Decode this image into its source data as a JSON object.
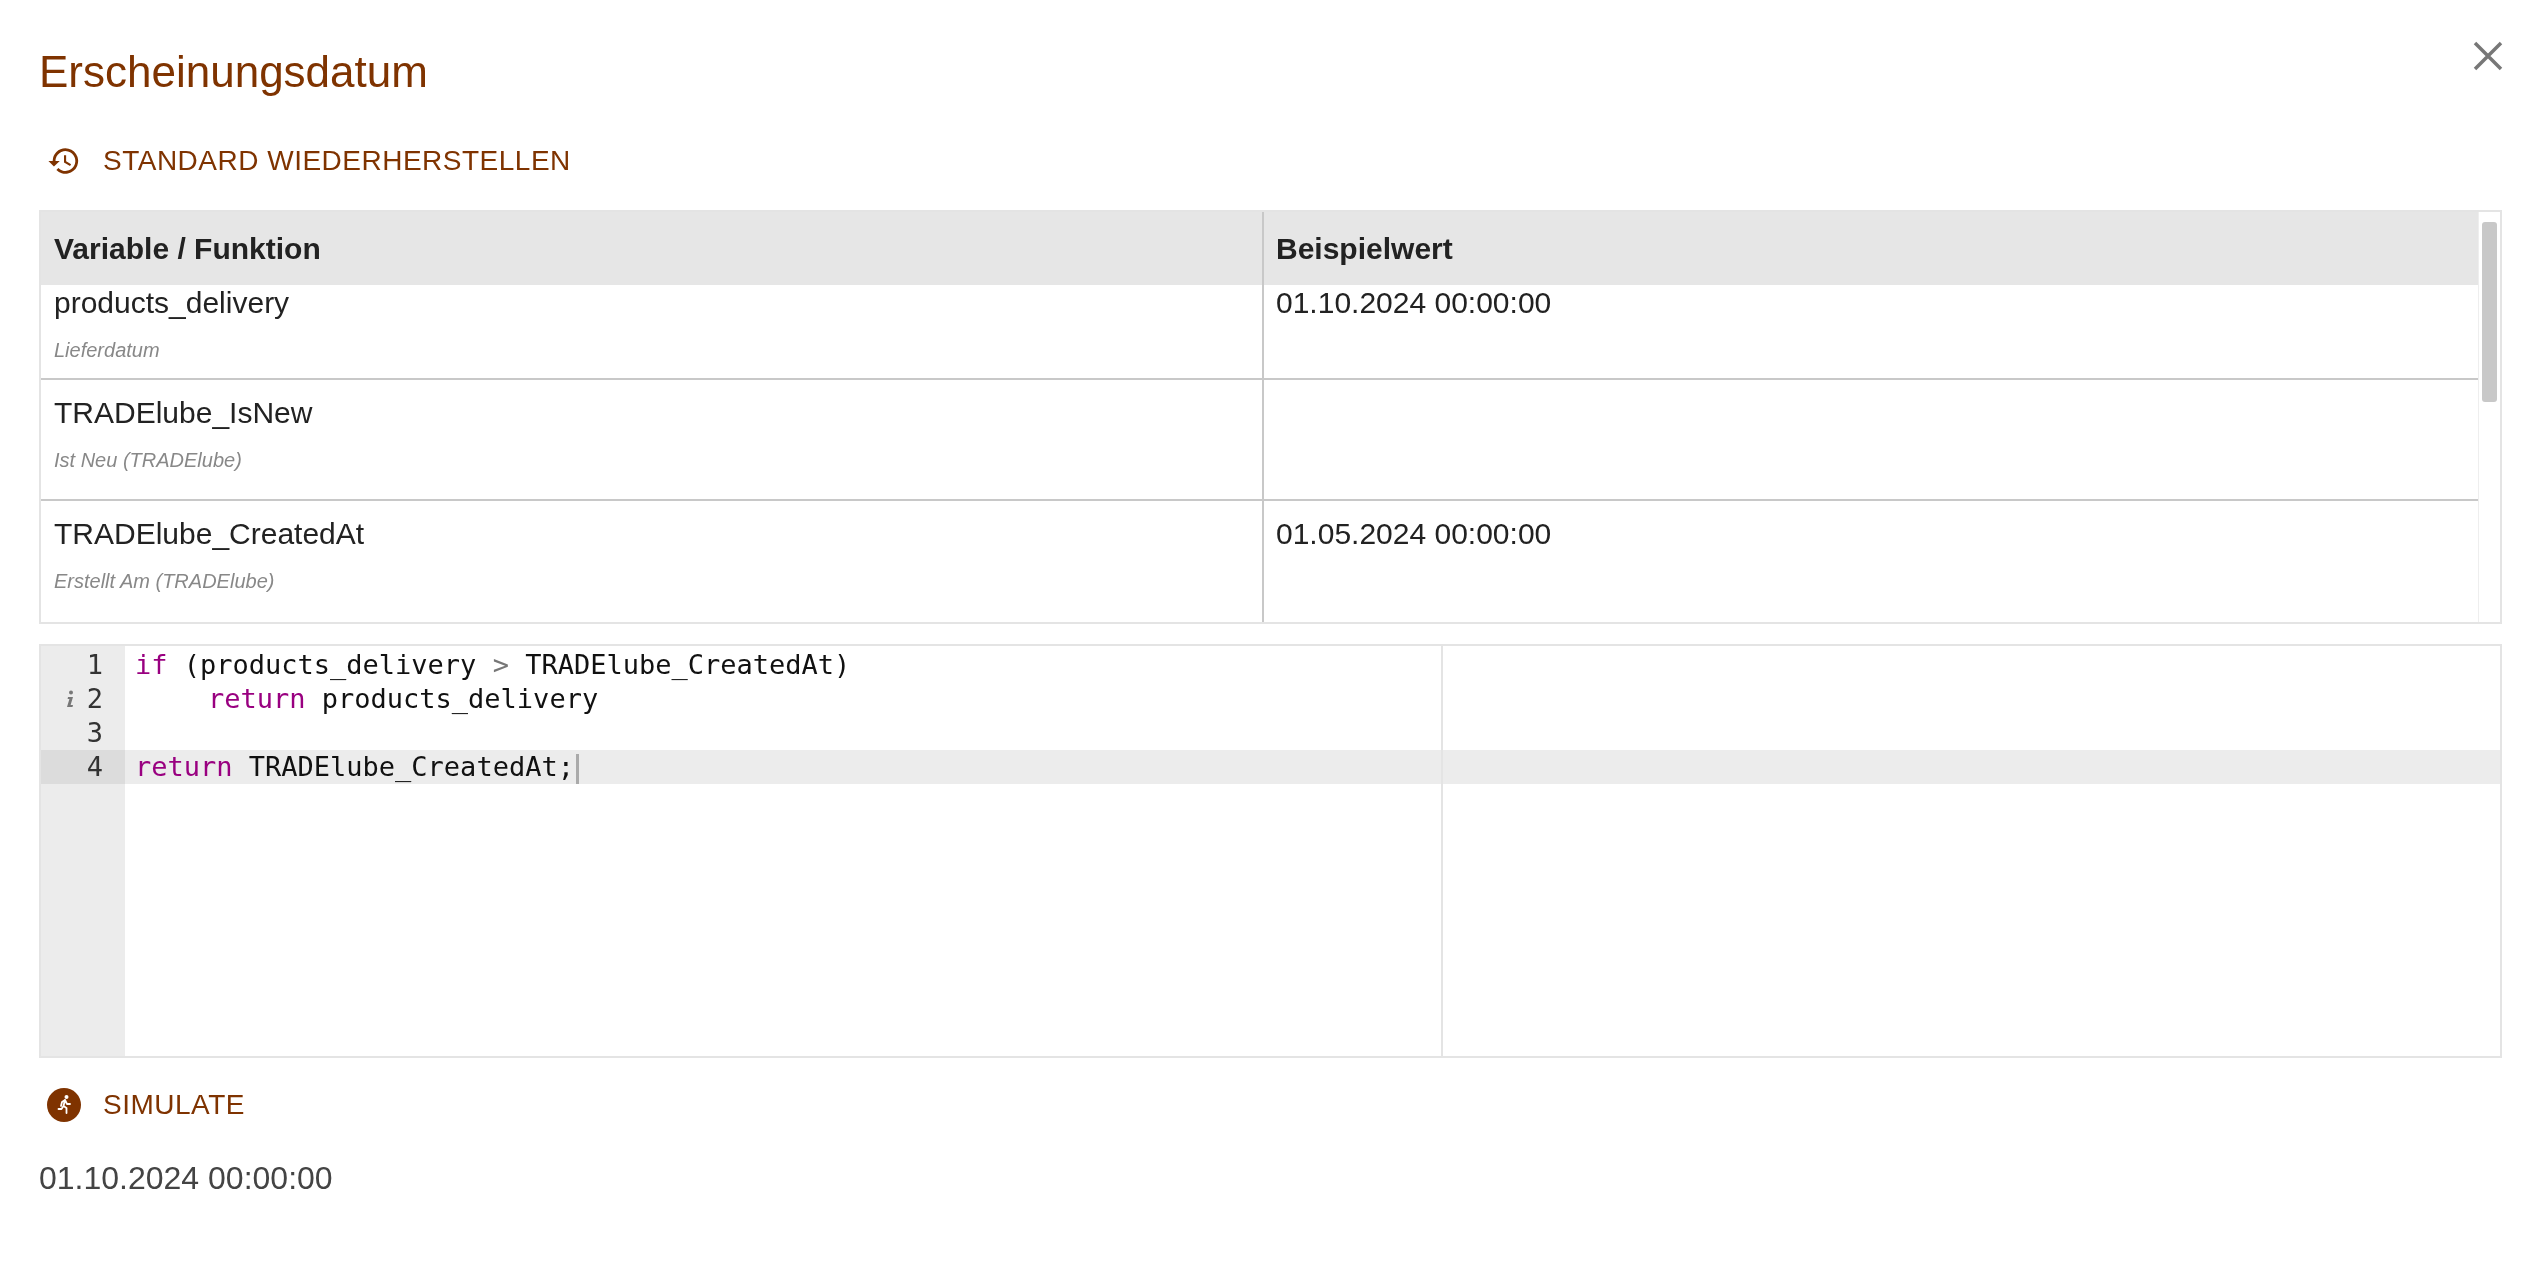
{
  "dialog": {
    "title": "Erscheinungsdatum"
  },
  "reset_button": {
    "label": "STANDARD WIEDERHERSTELLEN"
  },
  "table": {
    "columns": [
      "Variable / Funktion",
      "Beispielwert"
    ],
    "rows": [
      {
        "name": "products_delivery",
        "description": "Lieferdatum",
        "value": "01.10.2024 00:00:00"
      },
      {
        "name": "TRADElube_IsNew",
        "description": "Ist Neu (TRADElube)"
      },
      {
        "name": "TRADElube_CreatedAt",
        "description": "Erstellt Am (TRADElube)",
        "value": "01.05.2024 00:00:00"
      }
    ]
  },
  "editor": {
    "lines": [
      {
        "number": "1",
        "active": false,
        "tokens": [
          {
            "kind": "keyword",
            "text": "if"
          },
          {
            "kind": "plain",
            "text": " (products_delivery "
          },
          {
            "kind": "operator",
            "text": ">"
          },
          {
            "kind": "plain",
            "text": " TRADElube_CreatedAt)"
          }
        ]
      },
      {
        "number": "2",
        "active": false,
        "info_marker": true,
        "indented": true,
        "tokens": [
          {
            "kind": "keyword",
            "text": "return"
          },
          {
            "kind": "plain",
            "text": " products_delivery"
          }
        ]
      },
      {
        "number": "3",
        "active": false
      },
      {
        "number": "4",
        "active": true,
        "cursor": true,
        "tokens": [
          {
            "kind": "keyword",
            "text": "return"
          },
          {
            "kind": "plain",
            "text": " TRADElube_CreatedAt;"
          }
        ]
      }
    ]
  },
  "simulate_button": {
    "label": "SIMULATE"
  },
  "result": "01.10.2024 00:00:00"
}
